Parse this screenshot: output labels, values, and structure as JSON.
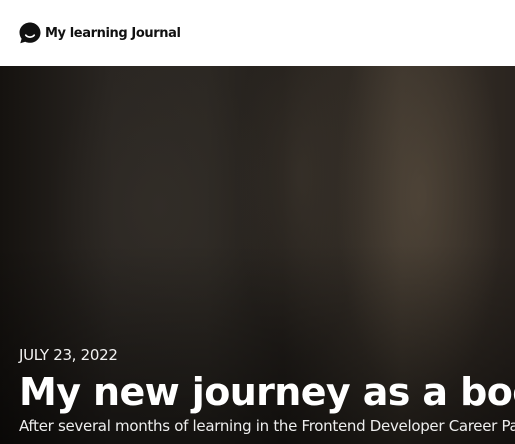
{
  "header": {
    "logo_icon": "chat-bubble-icon",
    "site_name": "My learning Journal"
  },
  "hero": {
    "date": "JULY 23, 2022",
    "title": "My new journey as a bootcamp student.",
    "excerpt": "After several months of learning in the Frontend Developer Career Path, I've made the big jump over to the Bootcamp to get expert code reviews of my Solo Projects projects and meet like-minded peers."
  },
  "colors": {
    "header_bg": "#ffffff",
    "text_dark": "#111111",
    "hero_text": "#ffffff"
  }
}
